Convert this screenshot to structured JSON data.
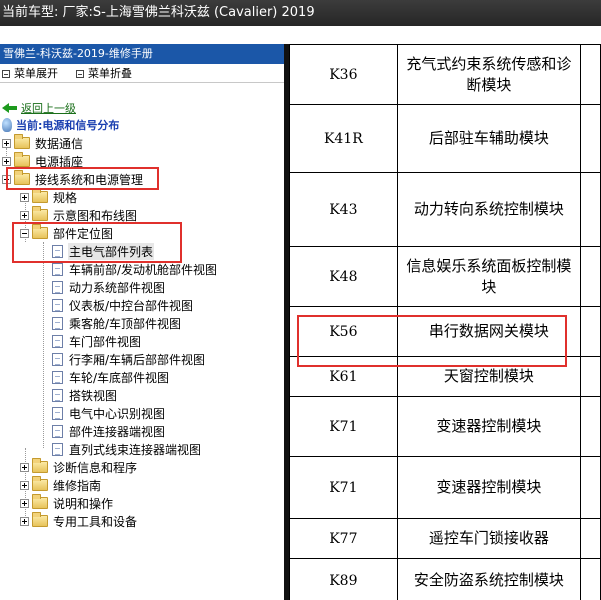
{
  "window": {
    "title": "当前车型:  厂家:S-上海雪佛兰科沃兹 (Cavalier) 2019"
  },
  "panel": {
    "header": "雪佛兰-科沃兹-2019-维修手册",
    "expand_all": "菜单展开",
    "collapse_all": "菜单折叠",
    "back_link": "返回上一级",
    "current_location": "当前:电源和信号分布"
  },
  "tree": {
    "data_comm": "数据通信",
    "power_socket": "电源插座",
    "wiring_power_mgmt": "接线系统和电源管理",
    "specs": "规格",
    "schematics": "示意图和布线图",
    "component_locator": "部件定位图",
    "main_components_list": "主电气部件列表",
    "front_engine_view": "车辆前部/发动机舱部件视图",
    "powertrain_view": "动力系统部件视图",
    "dash_console_view": "仪表板/中控台部件视图",
    "cabin_roof_view": "乘客舱/车顶部件视图",
    "door_view": "车门部件视图",
    "trunk_rear_view": "行李厢/车辆后部部件视图",
    "wheel_chassis_view": "车轮/车底部件视图",
    "ground_view": "搭铁视图",
    "center_id_view": "电气中心识别视图",
    "connector_end_view": "部件连接器端视图",
    "inline_harness_view": "直列式线束连接器端视图",
    "diagnostics": "诊断信息和程序",
    "repair_guide": "维修指南",
    "description_operation": "说明和操作",
    "special_tools": "专用工具和设备"
  },
  "table": {
    "rows": [
      {
        "code": "K36",
        "name": "充气式约束系统传感和诊断模块"
      },
      {
        "code": "K41R",
        "name": "后部驻车辅助模块"
      },
      {
        "code": "K43",
        "name": "动力转向系统控制模块"
      },
      {
        "code": "K48",
        "name": "信息娱乐系统面板控制模块"
      },
      {
        "code": "K56",
        "name": "串行数据网关模块"
      },
      {
        "code": "K61",
        "name": "天窗控制模块"
      },
      {
        "code": "K71",
        "name": "变速器控制模块"
      },
      {
        "code": "K71",
        "name": "变速器控制模块"
      },
      {
        "code": "K77",
        "name": "遥控车门锁接收器"
      },
      {
        "code": "K89",
        "name": "安全防盗系统控制模块"
      }
    ]
  },
  "colors": {
    "highlight_box": "#e0302c",
    "panel_header": "#1b57a8",
    "title_bar": "#2e2e2e"
  }
}
